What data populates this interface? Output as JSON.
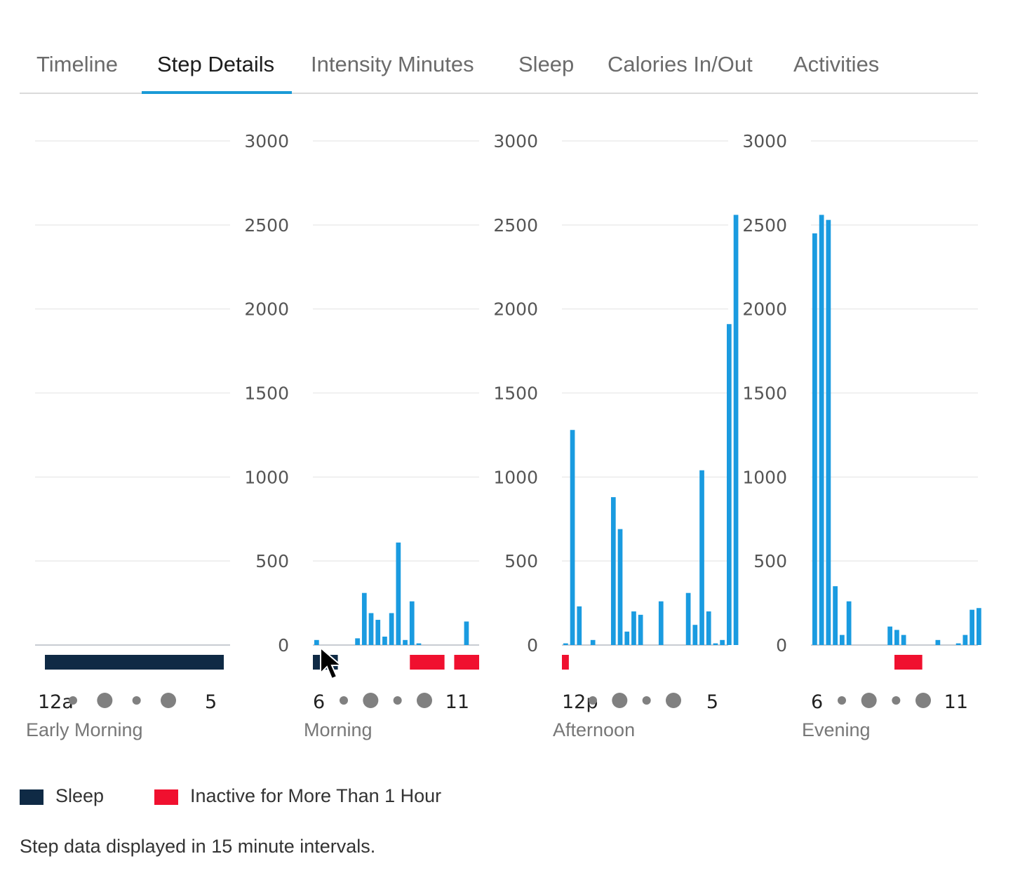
{
  "tabs": [
    {
      "label": "Timeline",
      "active": false
    },
    {
      "label": "Step Details",
      "active": true
    },
    {
      "label": "Intensity Minutes",
      "active": false
    },
    {
      "label": "Sleep",
      "active": false
    },
    {
      "label": "Calories In/Out",
      "active": false
    },
    {
      "label": "Activities",
      "active": false
    }
  ],
  "colors": {
    "accent": "#1a9ad6",
    "bar": "#1a9be0",
    "sleep": "#0f2a45",
    "inactive": "#f0102f",
    "grid": "#ebebeb",
    "axis_label": "#555555",
    "period_label": "#777777",
    "dot": "#808080"
  },
  "chart_data": [
    {
      "type": "bar",
      "period": "Early Morning",
      "x_labels": [
        "12a",
        "5"
      ],
      "y_ticks": [],
      "ylim": [
        0,
        3000
      ],
      "intervals_per_bar_minutes": 15,
      "values": [],
      "sleep_range_hours": [
        0,
        6
      ],
      "inactive_ranges_hours": []
    },
    {
      "type": "bar",
      "period": "Morning",
      "x_labels": [
        "6",
        "11"
      ],
      "y_ticks": [
        "0",
        "500",
        "1000",
        "1500",
        "2000",
        "2500",
        "3000"
      ],
      "ylim": [
        0,
        3000
      ],
      "intervals_per_bar_minutes": 15,
      "values": [
        30,
        0,
        0,
        0,
        0,
        0,
        40,
        310,
        190,
        150,
        50,
        190,
        610,
        30,
        260,
        10,
        0,
        0,
        0,
        0,
        0,
        0,
        140,
        0
      ],
      "sleep_range_hours": [
        0,
        0.9
      ],
      "inactive_ranges_hours": [
        [
          3.5,
          4.75
        ],
        [
          5.1,
          6.0
        ]
      ]
    },
    {
      "type": "bar",
      "period": "Afternoon",
      "x_labels": [
        "12p",
        "5"
      ],
      "y_ticks": [
        "0",
        "500",
        "1000",
        "1500",
        "2000",
        "2500",
        "3000"
      ],
      "ylim": [
        0,
        3000
      ],
      "intervals_per_bar_minutes": 15,
      "values": [
        10,
        1280,
        230,
        0,
        30,
        0,
        0,
        880,
        690,
        80,
        200,
        180,
        0,
        0,
        260,
        0,
        0,
        0,
        310,
        120,
        1040,
        200,
        10,
        30,
        1910,
        2560
      ],
      "sleep_range_hours": null,
      "inactive_ranges_hours": [
        [
          0,
          0.25
        ]
      ]
    },
    {
      "type": "bar",
      "period": "Evening",
      "x_labels": [
        "6",
        "11"
      ],
      "y_ticks": [
        "0",
        "500",
        "1000",
        "1500",
        "2000",
        "2500",
        "3000"
      ],
      "ylim": [
        0,
        3000
      ],
      "intervals_per_bar_minutes": 15,
      "values": [
        2450,
        2560,
        2530,
        350,
        60,
        260,
        0,
        0,
        0,
        0,
        0,
        110,
        90,
        60,
        0,
        0,
        0,
        0,
        30,
        0,
        0,
        10,
        60,
        210,
        220
      ],
      "sleep_range_hours": null,
      "inactive_ranges_hours": [
        [
          3.0,
          4.0
        ]
      ]
    }
  ],
  "legend": [
    {
      "label": "Sleep",
      "color": "#0f2a45"
    },
    {
      "label": "Inactive for More Than 1 Hour",
      "color": "#f0102f"
    }
  ],
  "footnote": "Step data displayed in 15 minute intervals."
}
